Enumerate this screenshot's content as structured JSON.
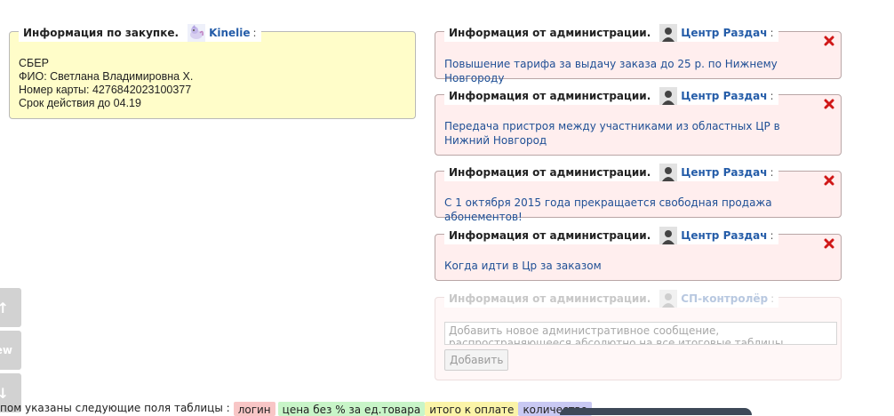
{
  "purchase": {
    "title": "Информация по закупке.",
    "user": "Kinelie",
    "colon": ":",
    "lines": [
      "СБЕР",
      "ФИО: Светлана Владимировна Х.",
      "Номер карты: 4276842023100377",
      "Срок действия до 04.19"
    ]
  },
  "admin": {
    "title": "Информация от администрации.",
    "colon": ":",
    "messages": [
      {
        "user": "Центр Раздач",
        "text": "Повышение тарифа за выдачу заказа до 25 р. по Нижнему Новгороду"
      },
      {
        "user": "Центр Раздач",
        "text": "Передача пристроя между участниками из областных ЦР в Нижний Новгород"
      },
      {
        "user": "Центр Раздач",
        "text": "С 1 октября 2015 года прекращается свободная продажа абонементов!"
      },
      {
        "user": "Центр Раздач",
        "text": "Когда идти в Цр за заказом"
      }
    ]
  },
  "form": {
    "title": "Информация от администрации.",
    "user": "СП-контролёр",
    "colon": ":",
    "placeholder": "Добавить новое административное сообщение, распространяющееся абсолютно на все итоговые таблицы",
    "button": "Добавить"
  },
  "side_buttons": [
    {
      "label": "↑",
      "icon": "arrow-up-icon"
    },
    {
      "label": "ew",
      "icon": "new-label"
    },
    {
      "label": "↓",
      "icon": "arrow-down-icon"
    }
  ],
  "bottom": {
    "prefix": "пом указаны следующие поля таблицы :",
    "tags": [
      {
        "label": "логин",
        "color": "#f8c6c6"
      },
      {
        "label": "цена без % за ед.товара",
        "color": "#c8f5c8"
      },
      {
        "label": "итого к оплате",
        "color": "#fbf4a8"
      },
      {
        "label": "количество",
        "color": "#c9c9f3"
      }
    ]
  },
  "colors": {
    "purchase_bg": "#fffdc9",
    "admin_bg": "#ffeeee",
    "link": "#1f4f95",
    "close": "#d01818"
  }
}
